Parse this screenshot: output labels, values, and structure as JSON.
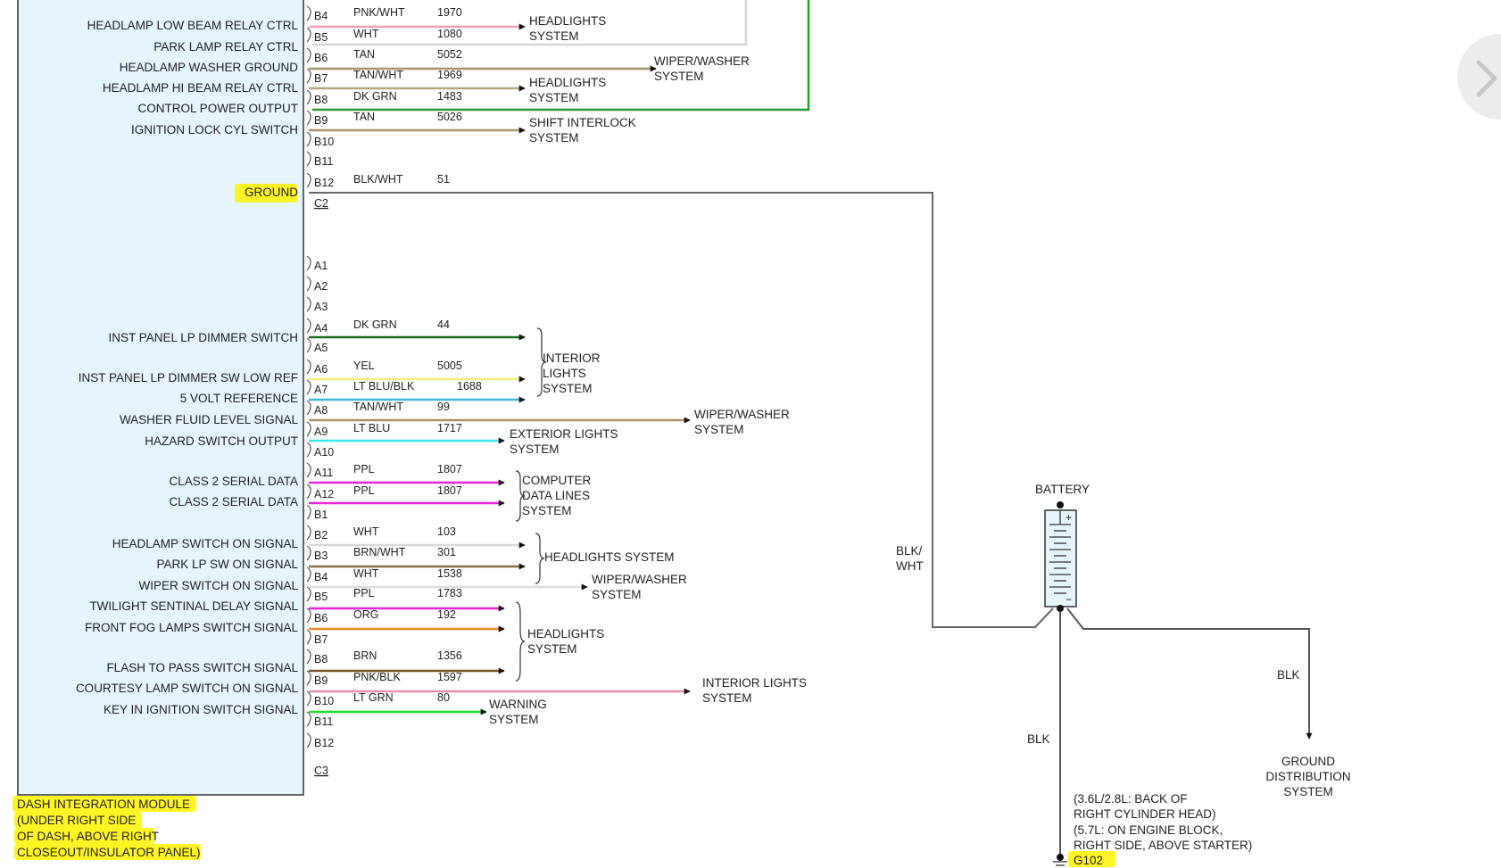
{
  "colors": {
    "PNK/WHT": "#f0a0b0",
    "WHT": "#d0d0d0",
    "TAN": "#a89468",
    "TAN/WHT": "#b8a478",
    "DK GRN": "#1a6e1a",
    "BLK/WHT": "#666666",
    "YEL": "#f5f07a",
    "LT BLU/BLK": "#3ab8d8",
    "LT BLU": "#3ee8f0",
    "PPL": "#ee22dd",
    "BRN/WHT": "#8a7040",
    "ORG": "#f08820",
    "BRN": "#7a5520",
    "PNK/BLK": "#e890a8",
    "LT GRN": "#22dd22",
    "BLK": "#555555",
    "module_fill": "#e6f4fb",
    "highlight": "#fff200",
    "green_box": "#2a9a2a"
  },
  "module": {
    "labels": [
      {
        "id": "headlamp-low-beam-relay-ctrl",
        "text": "HEADLAMP LOW BEAM RELAY CTRL",
        "row": 26
      },
      {
        "id": "park-lamp-relay-ctrl",
        "text": "PARK LAMP RELAY CTRL",
        "row": 48
      },
      {
        "id": "headlamp-washer-ground",
        "text": "HEADLAMP WASHER GROUND",
        "row": 70
      },
      {
        "id": "headlamp-hi-beam-relay-ctrl",
        "text": "HEADLAMP HI BEAM RELAY CTRL",
        "row": 91
      },
      {
        "id": "control-power-output",
        "text": "CONTROL POWER OUTPUT",
        "row": 113
      },
      {
        "id": "ignition-lock-cyl-switch",
        "text": "IGNITION LOCK CYL SWITCH",
        "row": 135
      },
      {
        "id": "ground",
        "text": "GROUND",
        "row": 200
      },
      {
        "id": "inst-panel-lp-dimmer-switch",
        "text": "INST PANEL LP DIMMER SWITCH",
        "row": 352
      },
      {
        "id": "inst-panel-lp-dimmer-sw-low-ref",
        "text": "INST PANEL LP DIMMER SW LOW REF",
        "row": 394
      },
      {
        "id": "5-volt-reference",
        "text": "5 VOLT REFERENCE",
        "row": 416
      },
      {
        "id": "washer-fluid-level-signal",
        "text": "WASHER FLUID LEVEL SIGNAL",
        "row": 438
      },
      {
        "id": "hazard-switch-output",
        "text": "HAZARD SWITCH OUTPUT",
        "row": 460
      },
      {
        "id": "class-2-serial-data-1",
        "text": "CLASS 2 SERIAL DATA",
        "row": 502
      },
      {
        "id": "class-2-serial-data-2",
        "text": "CLASS 2 SERIAL DATA",
        "row": 524
      },
      {
        "id": "headlamp-switch-on-signal",
        "text": "HEADLAMP SWITCH ON SIGNAL",
        "row": 568
      },
      {
        "id": "park-lp-sw-on-signal",
        "text": "PARK LP SW ON SIGNAL",
        "row": 589
      },
      {
        "id": "wiper-switch-on-signal",
        "text": "WIPER SWITCH ON SIGNAL",
        "row": 611
      },
      {
        "id": "twilight-sentinal-delay-signal",
        "text": "TWILIGHT SENTINAL DELAY SIGNAL",
        "row": 633
      },
      {
        "id": "front-fog-lamps-switch-signal",
        "text": "FRONT FOG LAMPS SWITCH SIGNAL",
        "row": 655
      },
      {
        "id": "flash-to-pass-switch-signal",
        "text": "FLASH TO PASS SWITCH SIGNAL",
        "row": 697
      },
      {
        "id": "courtesy-lamp-switch-on-signal",
        "text": "COURTESY LAMP SWITCH ON SIGNAL",
        "row": 719
      },
      {
        "id": "key-in-ignition-switch-signal",
        "text": "KEY IN IGNITION SWITCH SIGNAL",
        "row": 741
      }
    ],
    "caption": [
      "DASH INTEGRATION MODULE",
      "(UNDER RIGHT SIDE",
      "OF DASH, ABOVE RIGHT",
      "CLOSEOUT/INSULATOR PANEL)"
    ]
  },
  "pins": [
    {
      "pin": "B4",
      "row": 16,
      "color": "PNK/WHT",
      "circuit": "1970"
    },
    {
      "pin": "B5",
      "row": 38,
      "color": "WHT",
      "circuit": "1080"
    },
    {
      "pin": "B6",
      "row": 60,
      "color": "TAN",
      "circuit": "5052"
    },
    {
      "pin": "B7",
      "row": 81,
      "color": "TAN/WHT",
      "circuit": "1969"
    },
    {
      "pin": "B8",
      "row": 103,
      "color": "DK GRN",
      "circuit": "1483"
    },
    {
      "pin": "B9",
      "row": 125,
      "color": "TAN",
      "circuit": "5026"
    },
    {
      "pin": "B10",
      "row": 147,
      "color": "",
      "circuit": ""
    },
    {
      "pin": "B11",
      "row": 168,
      "color": "",
      "circuit": ""
    },
    {
      "pin": "B12",
      "row": 190,
      "color": "BLK/WHT",
      "circuit": "51"
    },
    {
      "pin": "C2",
      "row": 212,
      "color": "",
      "circuit": "",
      "connector": true
    },
    {
      "pin": "A1",
      "row": 277,
      "color": "",
      "circuit": ""
    },
    {
      "pin": "A2",
      "row": 298,
      "color": "",
      "circuit": ""
    },
    {
      "pin": "A3",
      "row": 320,
      "color": "",
      "circuit": ""
    },
    {
      "pin": "A4",
      "row": 342,
      "color": "DK GRN",
      "circuit": "44"
    },
    {
      "pin": "A5",
      "row": 363,
      "color": "",
      "circuit": ""
    },
    {
      "pin": "A6",
      "row": 385,
      "color": "YEL",
      "circuit": "5005"
    },
    {
      "pin": "A7",
      "row": 406,
      "color": "LT BLU/BLK",
      "circuit": "1688"
    },
    {
      "pin": "A8",
      "row": 428,
      "color": "TAN/WHT",
      "circuit": "99"
    },
    {
      "pin": "A9",
      "row": 450,
      "color": "LT BLU",
      "circuit": "1717"
    },
    {
      "pin": "A10",
      "row": 472,
      "color": "",
      "circuit": ""
    },
    {
      "pin": "A11",
      "row": 493,
      "color": "PPL",
      "circuit": "1807"
    },
    {
      "pin": "A12",
      "row": 515,
      "color": "PPL",
      "circuit": "1807"
    },
    {
      "pin": "B1",
      "row": 537,
      "color": "",
      "circuit": ""
    },
    {
      "pin": "B2",
      "row": 558,
      "color": "WHT",
      "circuit": "103"
    },
    {
      "pin": "B3",
      "row": 580,
      "color": "BRN/WHT",
      "circuit": "301"
    },
    {
      "pin": "B4",
      "row": 602,
      "color": "WHT",
      "circuit": "1538"
    },
    {
      "pin": "B5",
      "row": 623,
      "color": "PPL",
      "circuit": "1783"
    },
    {
      "pin": "B6",
      "row": 645,
      "color": "ORG",
      "circuit": "192"
    },
    {
      "pin": "B7",
      "row": 667,
      "color": "",
      "circuit": ""
    },
    {
      "pin": "B8",
      "row": 688,
      "color": "BRN",
      "circuit": "1356"
    },
    {
      "pin": "B9",
      "row": 710,
      "color": "PNK/BLK",
      "circuit": "1597"
    },
    {
      "pin": "B10",
      "row": 732,
      "color": "LT GRN",
      "circuit": "80"
    },
    {
      "pin": "B11",
      "row": 753,
      "color": "",
      "circuit": ""
    },
    {
      "pin": "B12",
      "row": 775,
      "color": "",
      "circuit": ""
    },
    {
      "pin": "C3",
      "row": 804,
      "color": "",
      "circuit": "",
      "connector": true
    }
  ],
  "destinations": [
    {
      "id": "headlights-system-1",
      "lines": [
        "HEADLIGHTS",
        "SYSTEM"
      ]
    },
    {
      "id": "wiper-washer-system-1",
      "lines": [
        "WIPER/WASHER",
        "SYSTEM"
      ]
    },
    {
      "id": "headlights-system-2",
      "lines": [
        "HEADLIGHTS",
        "SYSTEM"
      ]
    },
    {
      "id": "shift-interlock-system",
      "lines": [
        "SHIFT INTERLOCK",
        "SYSTEM"
      ]
    },
    {
      "id": "interior-lights-system-1",
      "lines": [
        "INTERIOR",
        "LIGHTS",
        "SYSTEM"
      ]
    },
    {
      "id": "wiper-washer-system-2",
      "lines": [
        "WIPER/WASHER",
        "SYSTEM"
      ]
    },
    {
      "id": "exterior-lights-system",
      "lines": [
        "EXTERIOR LIGHTS",
        "SYSTEM"
      ]
    },
    {
      "id": "computer-data-lines-system",
      "lines": [
        "COMPUTER",
        "DATA LINES",
        "SYSTEM"
      ]
    },
    {
      "id": "headlights-system-3",
      "lines": [
        "HEADLIGHTS SYSTEM"
      ]
    },
    {
      "id": "wiper-washer-system-3",
      "lines": [
        "WIPER/WASHER",
        "SYSTEM"
      ]
    },
    {
      "id": "headlights-system-4",
      "lines": [
        "HEADLIGHTS",
        "SYSTEM"
      ]
    },
    {
      "id": "interior-lights-system-2",
      "lines": [
        "INTERIOR LIGHTS",
        "SYSTEM"
      ]
    },
    {
      "id": "warning-system",
      "lines": [
        "WARNING",
        "SYSTEM"
      ]
    }
  ],
  "battery": {
    "label": "BATTERY",
    "plus": "+",
    "minus": "−",
    "cable_in_label": [
      "BLK/",
      "WHT"
    ],
    "cable_down_label": "BLK",
    "cable_right_label": "BLK",
    "ground_distribution": [
      "GROUND",
      "DISTRIBUTION",
      "SYSTEM"
    ],
    "ground_location": [
      "(3.6L/2.8L: BACK OF",
      "RIGHT CYLINDER HEAD)",
      "(5.7L: ON ENGINE BLOCK,",
      "RIGHT SIDE, ABOVE STARTER)"
    ],
    "ground_id": "G102"
  },
  "nav": {
    "icon": "chevron-right-icon"
  }
}
